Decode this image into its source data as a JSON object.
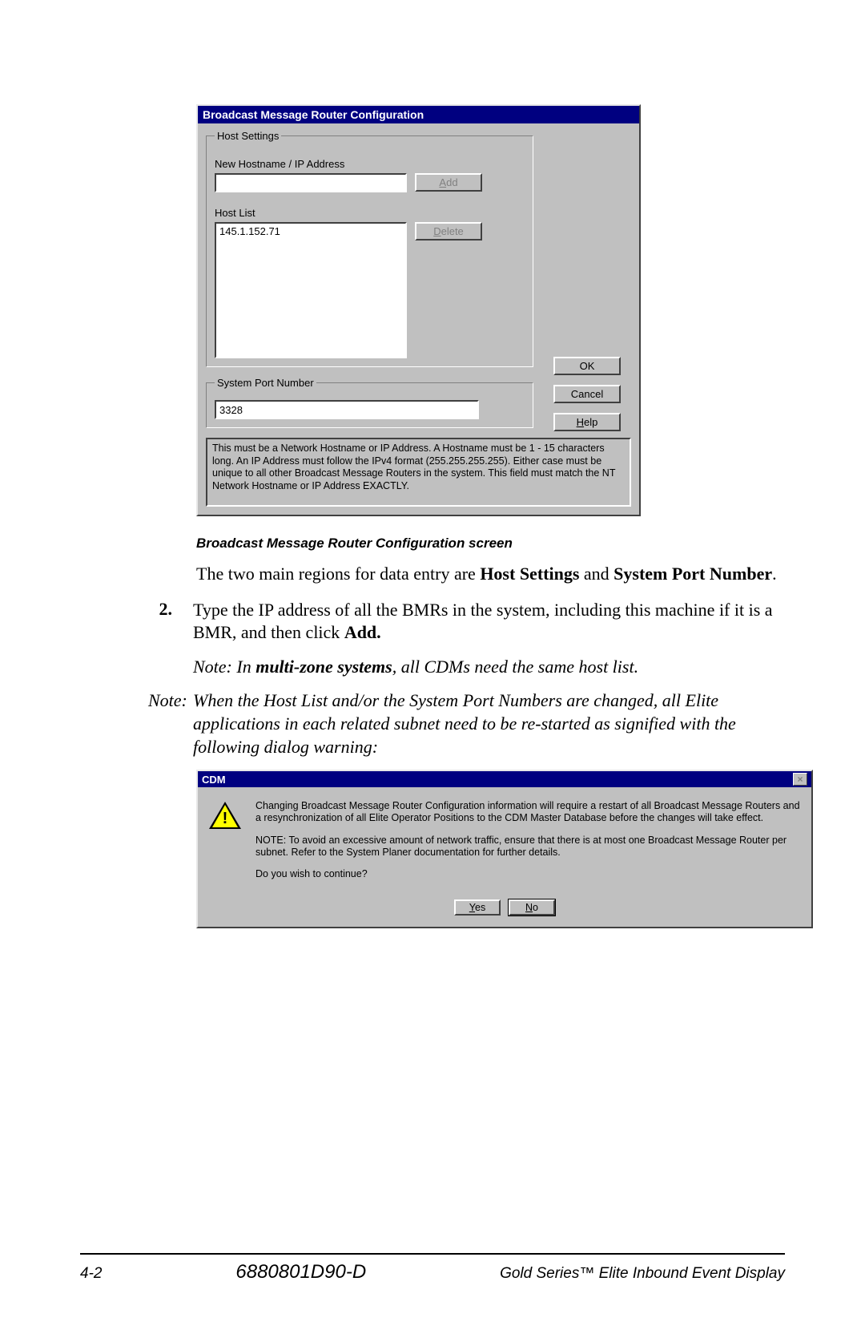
{
  "dialog1": {
    "title": "Broadcast Message Router Configuration",
    "host_settings_legend": "Host Settings",
    "new_hostname_label": "New Hostname / IP Address",
    "new_hostname_value": "",
    "add_button": "Add",
    "host_list_label": "Host List",
    "host_list_items": [
      "145.1.152.71"
    ],
    "delete_button": "Delete",
    "port_legend": "System Port Number",
    "port_value": "3328",
    "ok_button": "OK",
    "cancel_button": "Cancel",
    "help_button": "Help",
    "help_text": "This must be a Network Hostname or IP Address. A Hostname must be 1 - 15 characters long. An IP Address must follow the IPv4 format (255.255.255.255). Either case must be unique to all other Broadcast Message Routers in the system. This field must match the NT Network Hostname or IP Address EXACTLY."
  },
  "doc": {
    "caption": "Broadcast Message Router Configuration screen",
    "para1_a": "The two main regions for data entry are ",
    "para1_b_bold": "Host Settings",
    "para1_c": " and ",
    "para1_d_bold": "System Port Number",
    "para1_e": ".",
    "step_num": "2.",
    "step_a": "Type the IP address of all the BMRs in the system, including this machine if it is a BMR, and then click ",
    "step_b_bold": "Add.",
    "note1_a": "Note: In ",
    "note1_b_bold": "multi-zone systems",
    "note1_c": ", all CDMs need the same host list.",
    "note2_label": "Note:",
    "note2_body": "When the Host List and/or the System Port Numbers are changed, all Elite applications in each related subnet need to be re-started as signified with the following dialog warning:"
  },
  "dialog2": {
    "title": "CDM",
    "para1": "Changing Broadcast Message Router Configuration information will require a restart of all Broadcast Message Routers and a resynchronization of all Elite Operator Positions to the CDM Master Database before the changes will take effect.",
    "para2": "NOTE: To avoid an excessive amount of network traffic, ensure that there is at most one Broadcast Message Router per subnet.  Refer to the System Planer documentation for further details.",
    "para3": "Do you wish to continue?",
    "yes": "Yes",
    "no": "No"
  },
  "footer": {
    "left": "4-2",
    "mid": "6880801D90-D",
    "right": "Gold Series™ Elite Inbound Event Display"
  }
}
